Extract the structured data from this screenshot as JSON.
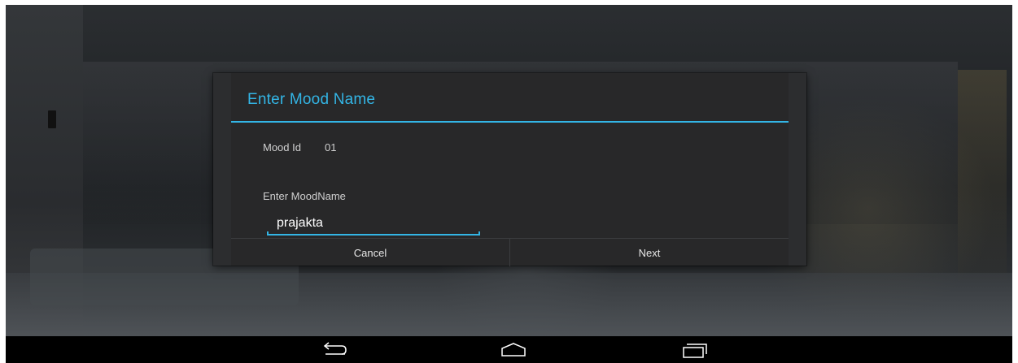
{
  "dialog": {
    "title": "Enter Mood Name",
    "mood_id_label": "Mood Id",
    "mood_id_value": "01",
    "moodname_label": "Enter MoodName",
    "moodname_value": "prajakta",
    "cancel_label": "Cancel",
    "next_label": "Next"
  },
  "navbar": {
    "icons": [
      "back-icon",
      "home-icon",
      "recent-apps-icon"
    ]
  },
  "colors": {
    "accent": "#33b5e5",
    "dialog_bg": "#282829",
    "navbar_bg": "#000000"
  }
}
